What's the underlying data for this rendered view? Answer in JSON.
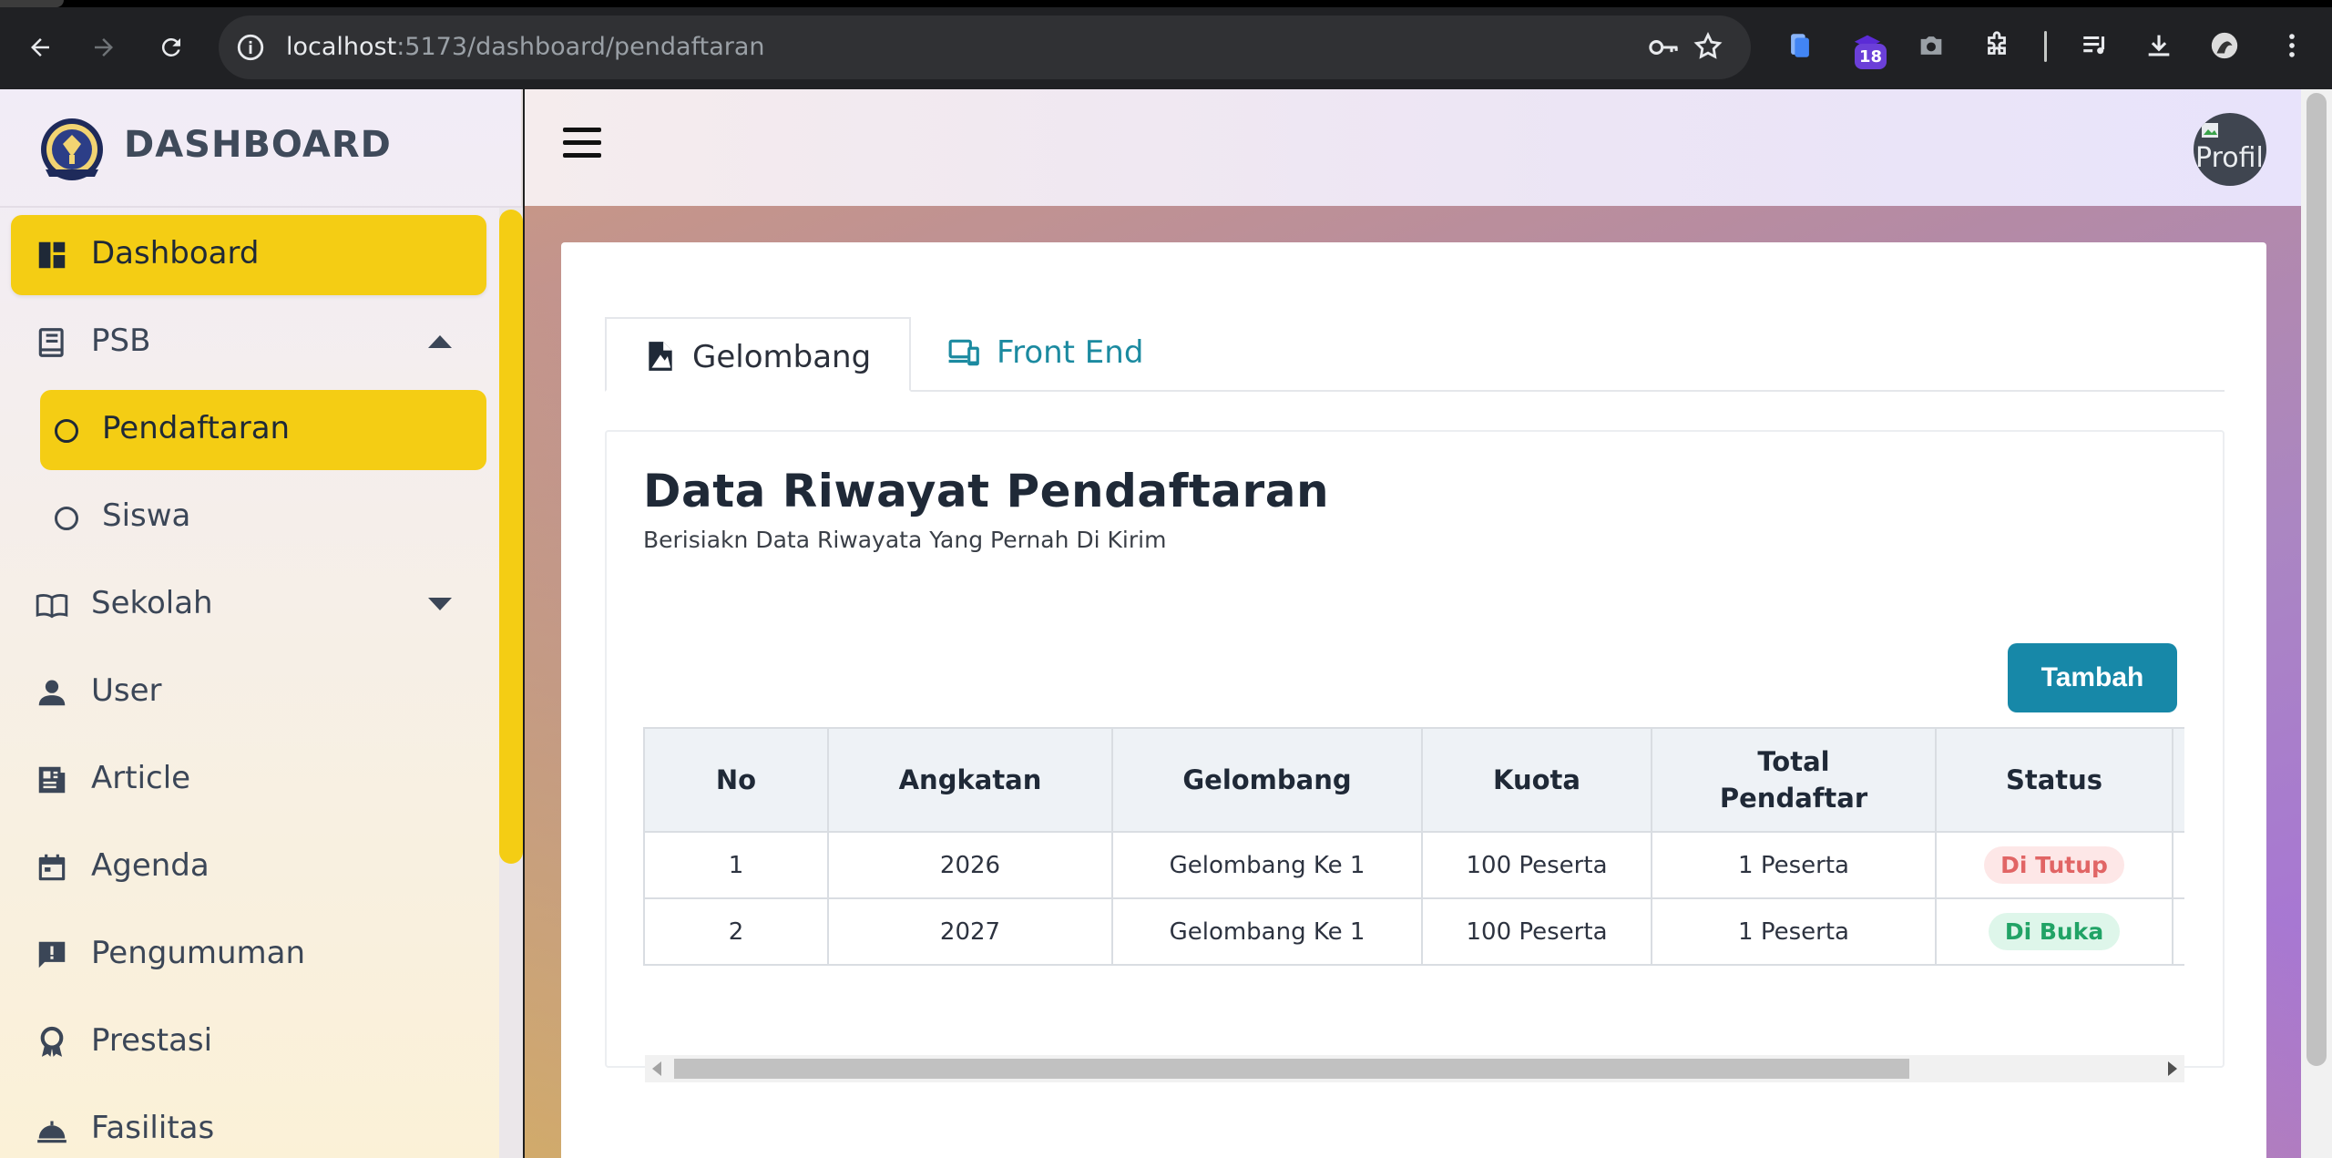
{
  "browser": {
    "url_host": "localhost",
    "url_path": ":5173/dashboard/pendaftaran",
    "extension_badge": "18"
  },
  "sidebar": {
    "brand": "DASHBOARD",
    "items": [
      {
        "label": "Dashboard",
        "icon": "dashboard-icon"
      },
      {
        "label": "PSB",
        "icon": "book-icon"
      },
      {
        "label": "Pendaftaran",
        "icon": "circle-icon"
      },
      {
        "label": "Siswa",
        "icon": "circle-icon"
      },
      {
        "label": "Sekolah",
        "icon": "open-book-icon"
      },
      {
        "label": "User",
        "icon": "user-icon"
      },
      {
        "label": "Article",
        "icon": "newspaper-icon"
      },
      {
        "label": "Agenda",
        "icon": "calendar-icon"
      },
      {
        "label": "Pengumuman",
        "icon": "announcement-icon"
      },
      {
        "label": "Prestasi",
        "icon": "award-icon"
      },
      {
        "label": "Fasilitas",
        "icon": "fasilitas-icon"
      }
    ]
  },
  "topbar": {
    "avatar_alt": "Profil"
  },
  "tabs": [
    {
      "label": "Gelombang",
      "icon": "document-icon"
    },
    {
      "label": "Front End",
      "icon": "devices-icon"
    }
  ],
  "panel": {
    "title": "Data Riwayat Pendaftaran",
    "subtitle": "Berisiakn Data Riwayata Yang Pernah Di Kirim",
    "add_button": "Tambah"
  },
  "table": {
    "headers": [
      "No",
      "Angkatan",
      "Gelombang",
      "Kuota",
      "Total Pendaftar",
      "Status"
    ],
    "rows": [
      {
        "no": "1",
        "angkatan": "2026",
        "gelombang": "Gelombang Ke 1",
        "kuota": "100 Peserta",
        "total": "1 Peserta",
        "status": "Di Tutup"
      },
      {
        "no": "2",
        "angkatan": "2027",
        "gelombang": "Gelombang Ke 1",
        "kuota": "100 Peserta",
        "total": "1 Peserta",
        "status": "Di Buka"
      }
    ]
  },
  "colors": {
    "accent_yellow": "#f4cd14",
    "primary_teal": "#1788a8",
    "status_closed": "#e16565",
    "status_open": "#21a366"
  }
}
